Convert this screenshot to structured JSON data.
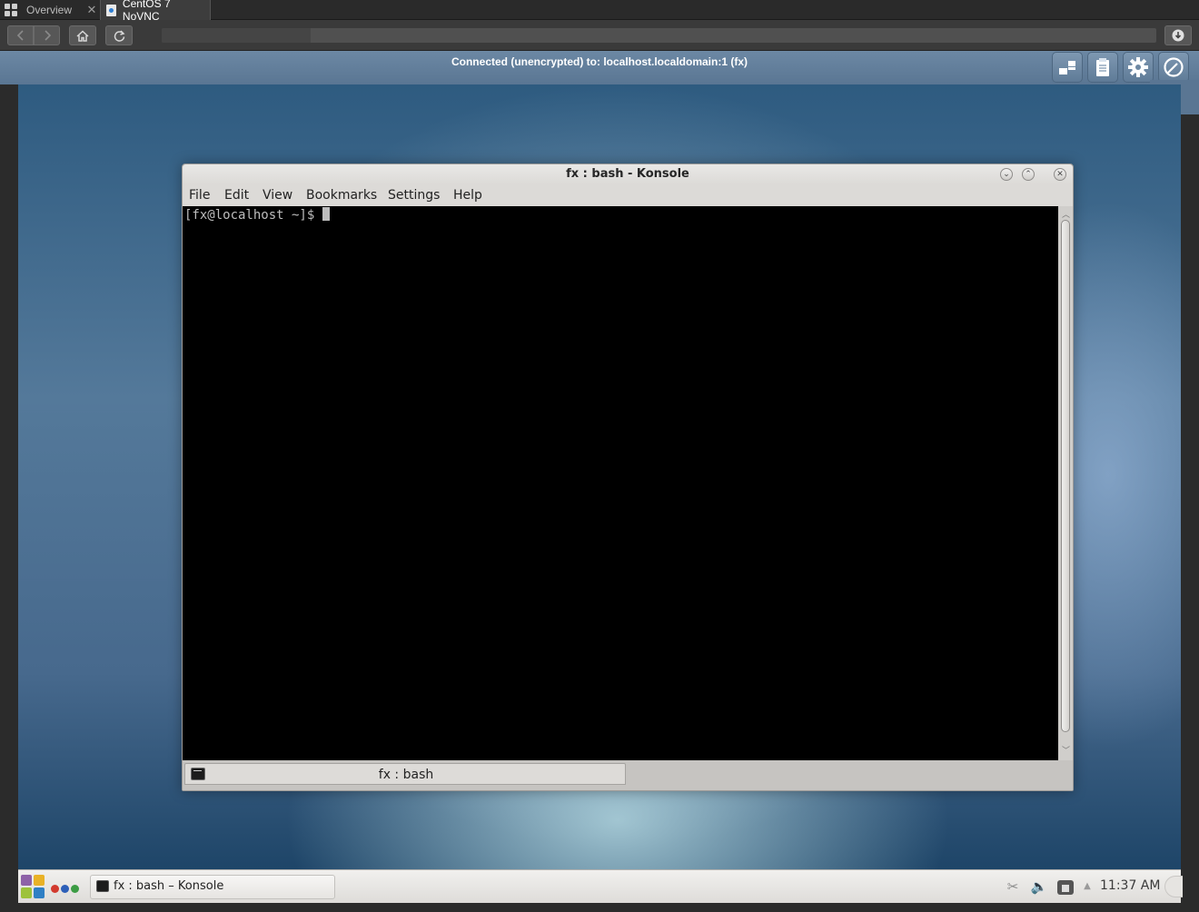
{
  "browser": {
    "tabs": [
      {
        "label": "Overview"
      },
      {
        "label": "CentOS 7 NoVNC"
      }
    ],
    "address_bar": {
      "value": "",
      "load_progress": 0.15
    }
  },
  "novnc": {
    "status": "Connected (unencrypted) to: localhost.localdomain:1 (fx)",
    "buttons": [
      "display-icon",
      "clipboard-icon",
      "settings-gear-icon",
      "disconnect-icon"
    ]
  },
  "konsole": {
    "title": "fx : bash - Konsole",
    "menu": [
      "File",
      "Edit",
      "View",
      "Bookmarks",
      "Settings",
      "Help"
    ],
    "prompt": "[fx@localhost ~]$ ",
    "tab_label": "fx : bash",
    "colors": {
      "terminal_bg": "#000000",
      "terminal_fg": "#bdbdbd"
    }
  },
  "panel": {
    "task_label": "fx : bash – Konsole",
    "clock": "11:37 AM",
    "tray_icons": [
      "klipper-icon",
      "volume-icon",
      "printer-icon",
      "tray-expand-icon"
    ]
  }
}
